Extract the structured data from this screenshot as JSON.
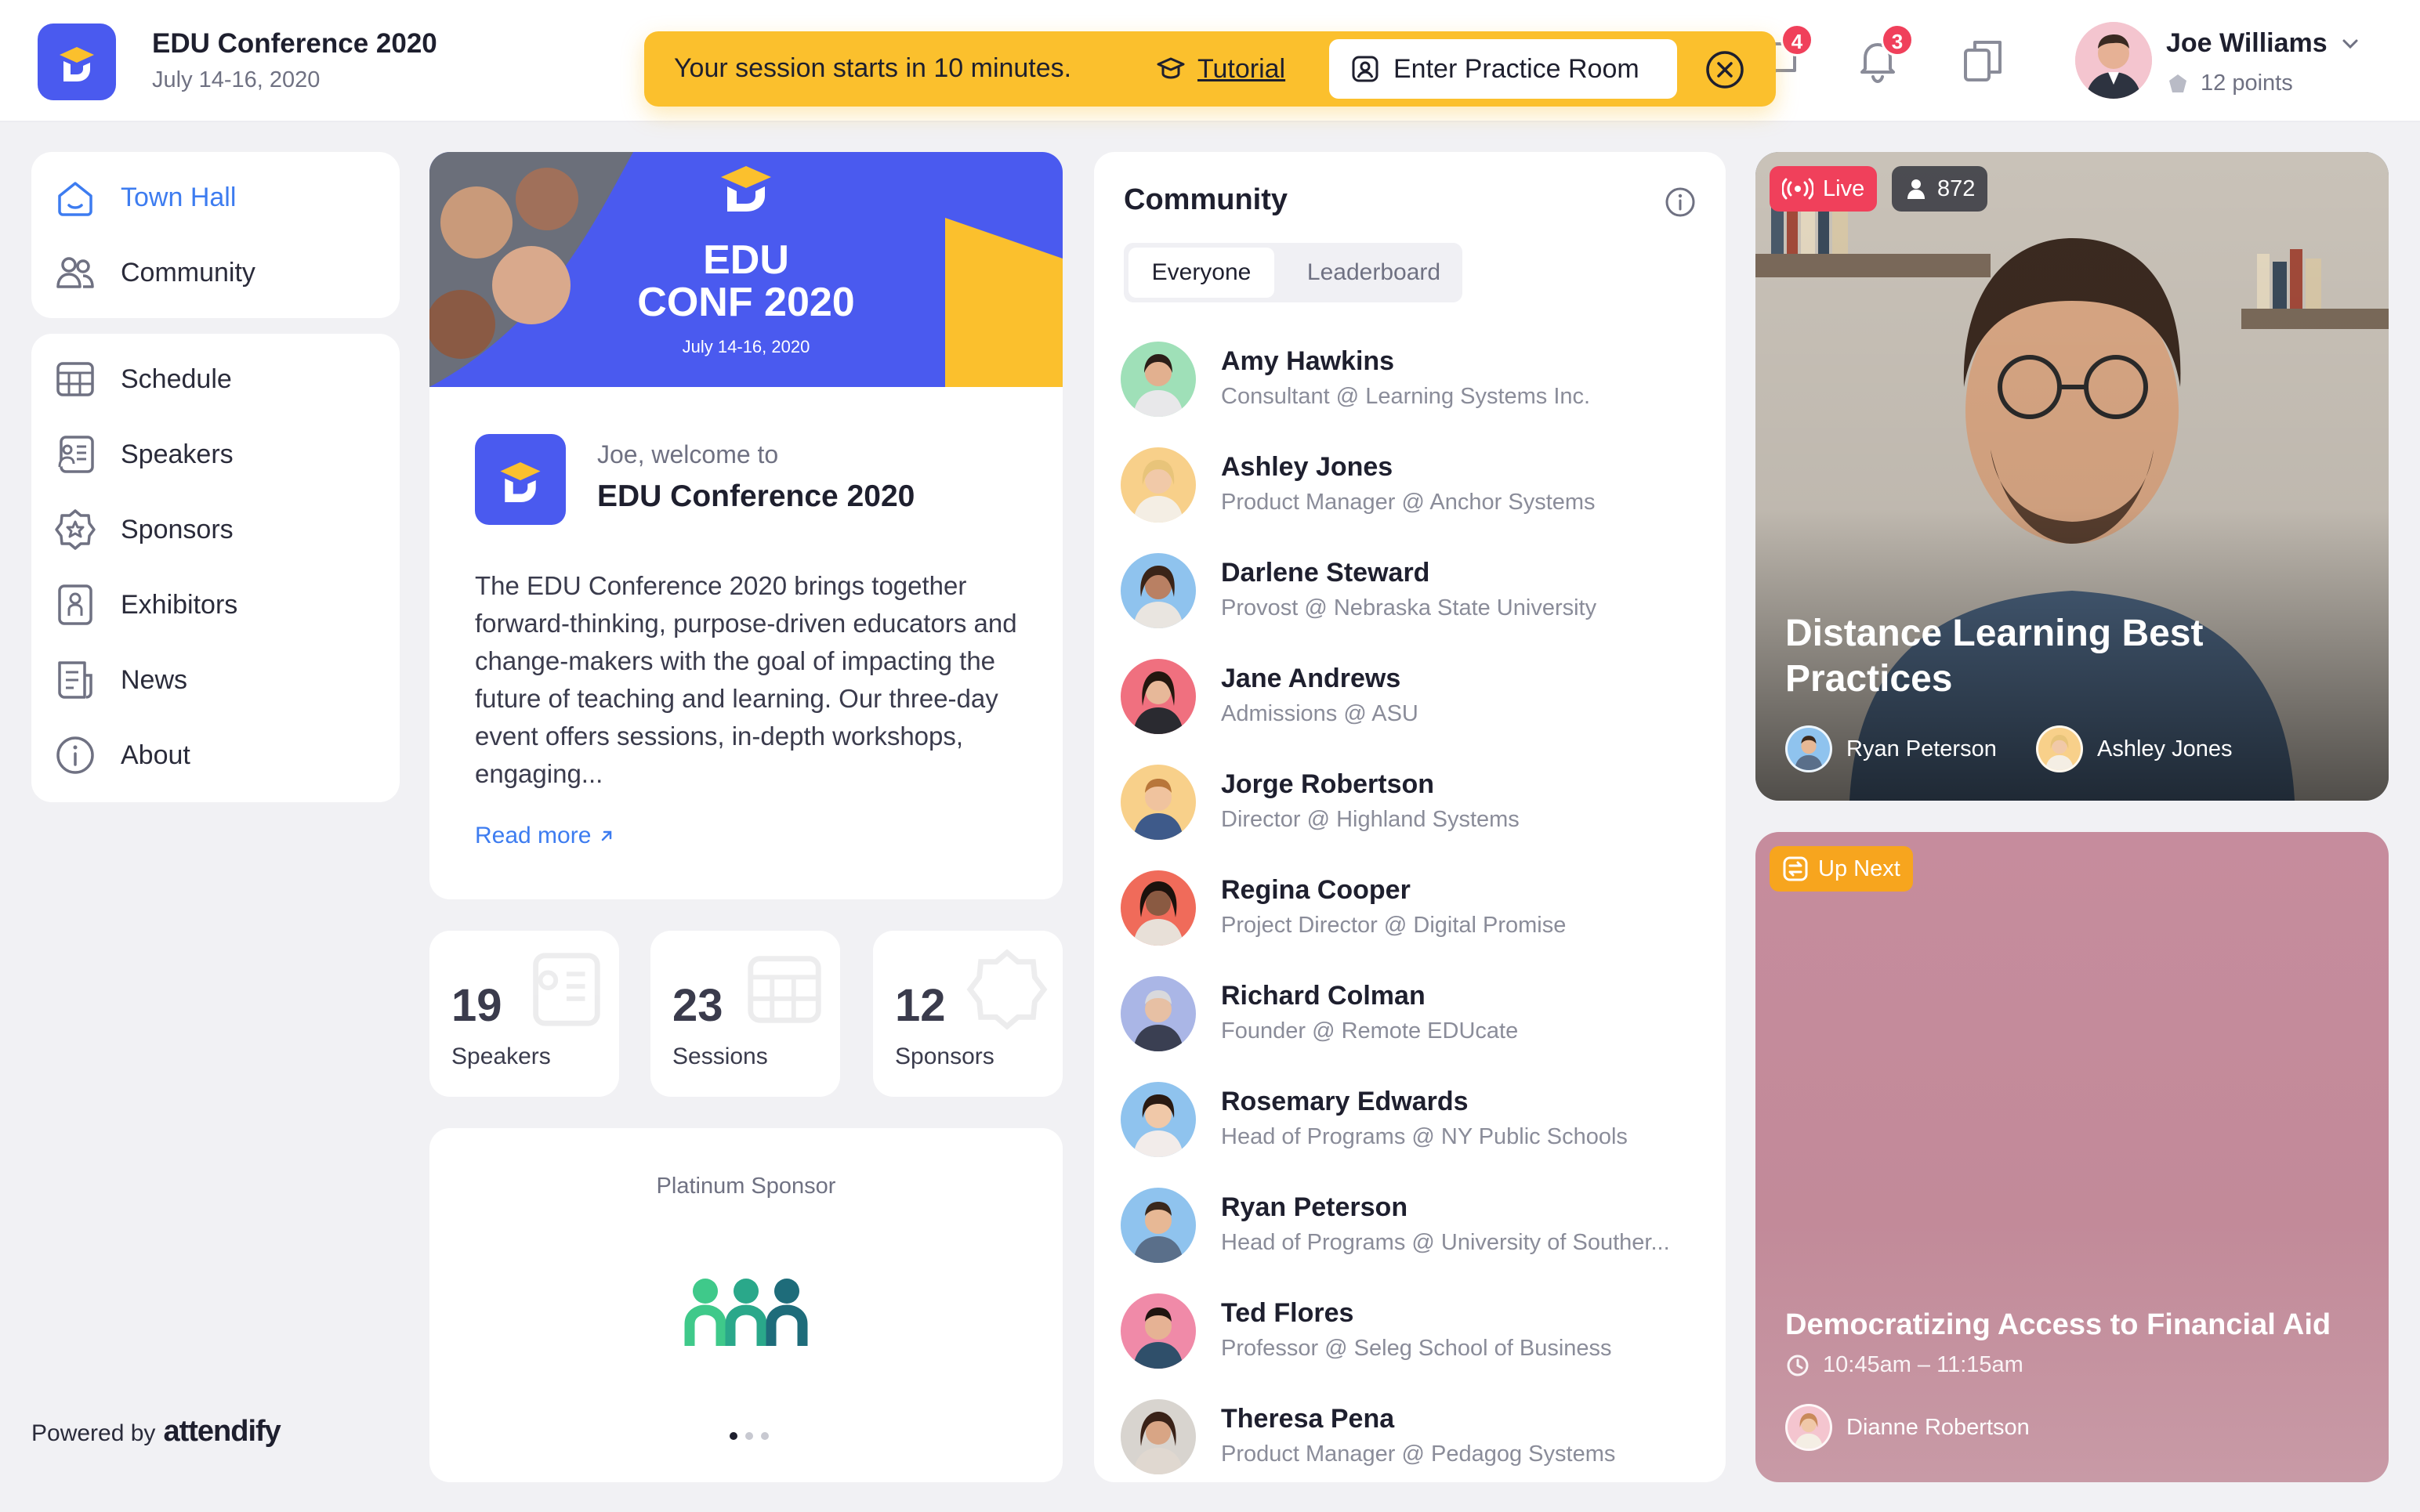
{
  "app": {
    "title": "EDU Conference 2020",
    "dates": "July 14-16, 2020"
  },
  "banner": {
    "message": "Your session starts in 10 minutes.",
    "tutorial_label": "Tutorial",
    "practice_label": "Enter Practice Room"
  },
  "notifications": {
    "chat_count": "4",
    "alerts_count": "3"
  },
  "user": {
    "name": "Joe Williams",
    "points": "12 points"
  },
  "nav": {
    "primary": [
      {
        "label": "Town Hall",
        "icon": "home-icon",
        "active": true
      },
      {
        "label": "Community",
        "icon": "people-icon",
        "active": false
      }
    ],
    "secondary": [
      {
        "label": "Schedule",
        "icon": "calendar-grid-icon"
      },
      {
        "label": "Speakers",
        "icon": "speaker-card-icon"
      },
      {
        "label": "Sponsors",
        "icon": "badge-star-icon"
      },
      {
        "label": "Exhibitors",
        "icon": "exhibitor-icon"
      },
      {
        "label": "News",
        "icon": "news-icon"
      },
      {
        "label": "About",
        "icon": "info-icon"
      }
    ],
    "powered_by": "Powered by",
    "powered_brand": "attendify"
  },
  "welcome": {
    "hero_line1": "EDU",
    "hero_line2": "CONF 2020",
    "hero_dates": "July 14-16, 2020",
    "greeting": "Joe, welcome to",
    "event_name": "EDU Conference 2020",
    "description": "The EDU Conference 2020 brings together forward-thinking, purpose-driven educators and change-makers with the goal of impacting the future of teaching and learning. Our three-day event offers sessions, in-depth workshops, engaging...",
    "read_more": "Read more"
  },
  "stats": [
    {
      "value": "19",
      "label": "Speakers"
    },
    {
      "value": "23",
      "label": "Sessions"
    },
    {
      "value": "12",
      "label": "Sponsors"
    }
  ],
  "sponsor": {
    "label": "Platinum Sponsor"
  },
  "community": {
    "title": "Community",
    "tab_everyone": "Everyone",
    "tab_leaderboard": "Leaderboard",
    "members": [
      {
        "name": "Amy Hawkins",
        "role": "Consultant @ Learning Systems Inc."
      },
      {
        "name": "Ashley Jones",
        "role": "Product Manager @ Anchor Systems"
      },
      {
        "name": "Darlene Steward",
        "role": "Provost @ Nebraska State University"
      },
      {
        "name": "Jane Andrews",
        "role": "Admissions @ ASU"
      },
      {
        "name": "Jorge Robertson",
        "role": "Director @ Highland Systems"
      },
      {
        "name": "Regina Cooper",
        "role": "Project Director @ Digital Promise"
      },
      {
        "name": "Richard Colman",
        "role": "Founder @ Remote EDUcate"
      },
      {
        "name": "Rosemary Edwards",
        "role": "Head of Programs @ NY Public Schools"
      },
      {
        "name": "Ryan Peterson",
        "role": "Head of Programs @ University of Souther..."
      },
      {
        "name": "Ted Flores",
        "role": "Professor @ Seleg School of Business"
      },
      {
        "name": "Theresa Pena",
        "role": "Product Manager @ Pedagog Systems"
      }
    ]
  },
  "live_session": {
    "live_label": "Live",
    "viewer_count": "872",
    "title": "Distance Learning Best Practices",
    "speakers": [
      "Ryan Peterson",
      "Ashley Jones"
    ]
  },
  "up_next": {
    "label": "Up Next",
    "title": "Democratizing Access to Financial Aid",
    "time": "10:45am – 11:15am",
    "speaker": "Dianne Robertson"
  },
  "colors": {
    "brand": "#4a5aef",
    "accent_yellow": "#fbc02d",
    "link_blue": "#3d7cf0",
    "live_red": "#f0405b",
    "up_next_orange": "#f7a51e"
  }
}
